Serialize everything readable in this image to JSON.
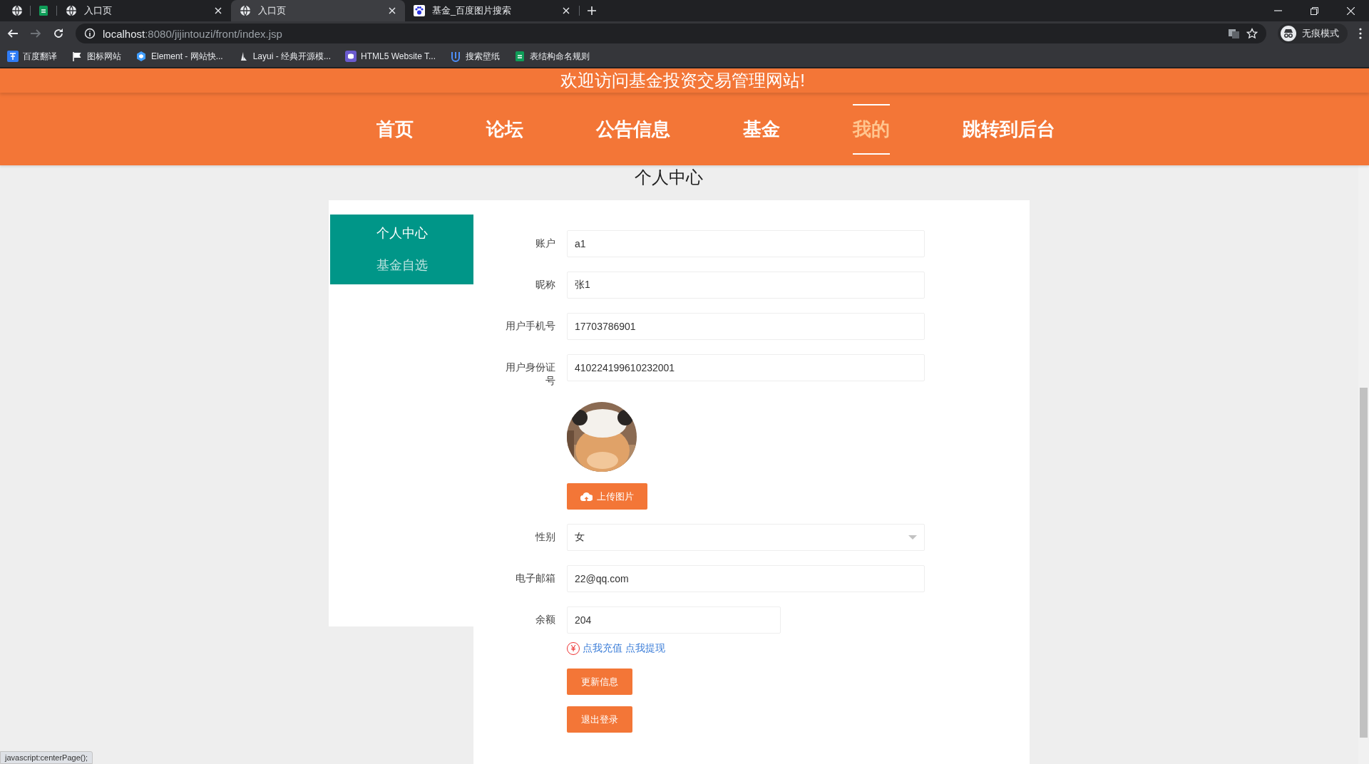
{
  "browser": {
    "tabs": [
      {
        "pinned": true,
        "selected": false
      },
      {
        "pinned": true,
        "selected": false
      },
      {
        "pinned": false,
        "title": "入口页",
        "selected": false
      },
      {
        "pinned": false,
        "title": "入口页",
        "selected": true
      },
      {
        "pinned": false,
        "title": "基金_百度图片搜索",
        "selected": false
      }
    ],
    "url_host": "localhost",
    "url_rest": ":8080/jijintouzi/front/index.jsp",
    "profile": "无痕模式",
    "bookmarks": [
      {
        "label": "百度翻译"
      },
      {
        "label": "图标网站"
      },
      {
        "label": "Element - 网站快..."
      },
      {
        "label": "Layui - 经典开源模..."
      },
      {
        "label": "HTML5 Website T..."
      },
      {
        "label": "搜索壁纸"
      },
      {
        "label": "表结构命名规则"
      }
    ],
    "status_text": "javascript:centerPage();"
  },
  "header": {
    "welcome": "欢迎访问基金投资交易管理网站!",
    "nav": [
      {
        "label": "首页",
        "selected": false
      },
      {
        "label": "论坛",
        "selected": false
      },
      {
        "label": "公告信息",
        "selected": false
      },
      {
        "label": "基金",
        "selected": false
      },
      {
        "label": "我的",
        "selected": true
      },
      {
        "label": "跳转到后台",
        "selected": false
      }
    ]
  },
  "page_title": "个人中心",
  "sidebar": {
    "items": [
      {
        "label": "个人中心",
        "selected": true
      },
      {
        "label": "基金自选",
        "selected": false
      }
    ]
  },
  "form": {
    "fields": [
      {
        "kind": "text",
        "label": "账户",
        "value": "a1"
      },
      {
        "kind": "text",
        "label": "昵称",
        "value": "张1"
      },
      {
        "kind": "text",
        "label": "用户手机号",
        "value": "17703786901"
      },
      {
        "kind": "text",
        "label": "用户身份证号",
        "value": "410224199610232001"
      },
      {
        "kind": "avatar",
        "upload_label": "上传图片"
      },
      {
        "kind": "select",
        "label": "性别",
        "value": "女"
      },
      {
        "kind": "text",
        "label": "电子邮箱",
        "value": "22@qq.com"
      },
      {
        "kind": "short",
        "label": "余额",
        "value": "204"
      }
    ],
    "balance_icon": "¥",
    "links": [
      "点我充值",
      "点我提现"
    ],
    "buttons": [
      "更新信息",
      "退出登录"
    ]
  }
}
